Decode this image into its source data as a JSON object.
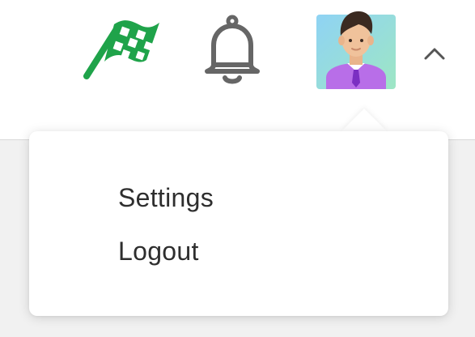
{
  "header": {
    "icons": {
      "flag": "checkered-flag-icon",
      "bell": "bell-icon",
      "avatar": "user-avatar",
      "toggle": "chevron-up-icon"
    },
    "toggle_glyph": "^"
  },
  "user_menu": {
    "items": [
      {
        "label": "Settings"
      },
      {
        "label": "Logout"
      }
    ]
  },
  "colors": {
    "flag_green": "#1fa34a",
    "bell_gray": "#666666",
    "avatar_shirt": "#b86ee8",
    "tie": "#7b2fc2",
    "menu_text": "#2e2e2e"
  }
}
